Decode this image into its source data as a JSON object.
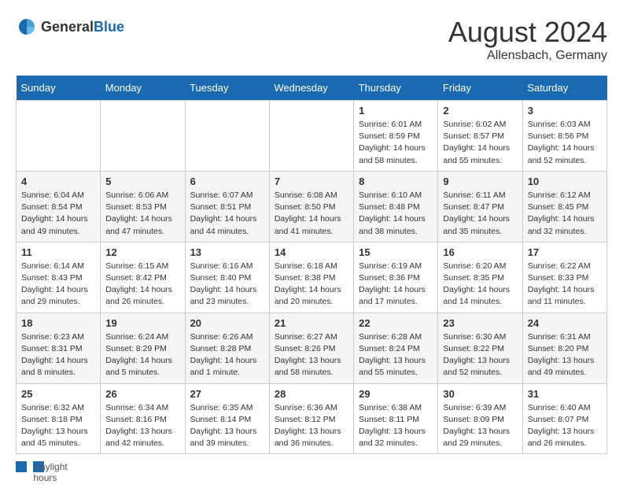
{
  "header": {
    "logo_general": "General",
    "logo_blue": "Blue",
    "month_year": "August 2024",
    "location": "Allensbach, Germany"
  },
  "days_of_week": [
    "Sunday",
    "Monday",
    "Tuesday",
    "Wednesday",
    "Thursday",
    "Friday",
    "Saturday"
  ],
  "weeks": [
    [
      {
        "day": "",
        "info": ""
      },
      {
        "day": "",
        "info": ""
      },
      {
        "day": "",
        "info": ""
      },
      {
        "day": "",
        "info": ""
      },
      {
        "day": "1",
        "sunrise": "Sunrise: 6:01 AM",
        "sunset": "Sunset: 8:59 PM",
        "daylight": "Daylight: 14 hours and 58 minutes."
      },
      {
        "day": "2",
        "sunrise": "Sunrise: 6:02 AM",
        "sunset": "Sunset: 8:57 PM",
        "daylight": "Daylight: 14 hours and 55 minutes."
      },
      {
        "day": "3",
        "sunrise": "Sunrise: 6:03 AM",
        "sunset": "Sunset: 8:56 PM",
        "daylight": "Daylight: 14 hours and 52 minutes."
      }
    ],
    [
      {
        "day": "4",
        "sunrise": "Sunrise: 6:04 AM",
        "sunset": "Sunset: 8:54 PM",
        "daylight": "Daylight: 14 hours and 49 minutes."
      },
      {
        "day": "5",
        "sunrise": "Sunrise: 6:06 AM",
        "sunset": "Sunset: 8:53 PM",
        "daylight": "Daylight: 14 hours and 47 minutes."
      },
      {
        "day": "6",
        "sunrise": "Sunrise: 6:07 AM",
        "sunset": "Sunset: 8:51 PM",
        "daylight": "Daylight: 14 hours and 44 minutes."
      },
      {
        "day": "7",
        "sunrise": "Sunrise: 6:08 AM",
        "sunset": "Sunset: 8:50 PM",
        "daylight": "Daylight: 14 hours and 41 minutes."
      },
      {
        "day": "8",
        "sunrise": "Sunrise: 6:10 AM",
        "sunset": "Sunset: 8:48 PM",
        "daylight": "Daylight: 14 hours and 38 minutes."
      },
      {
        "day": "9",
        "sunrise": "Sunrise: 6:11 AM",
        "sunset": "Sunset: 8:47 PM",
        "daylight": "Daylight: 14 hours and 35 minutes."
      },
      {
        "day": "10",
        "sunrise": "Sunrise: 6:12 AM",
        "sunset": "Sunset: 8:45 PM",
        "daylight": "Daylight: 14 hours and 32 minutes."
      }
    ],
    [
      {
        "day": "11",
        "sunrise": "Sunrise: 6:14 AM",
        "sunset": "Sunset: 8:43 PM",
        "daylight": "Daylight: 14 hours and 29 minutes."
      },
      {
        "day": "12",
        "sunrise": "Sunrise: 6:15 AM",
        "sunset": "Sunset: 8:42 PM",
        "daylight": "Daylight: 14 hours and 26 minutes."
      },
      {
        "day": "13",
        "sunrise": "Sunrise: 6:16 AM",
        "sunset": "Sunset: 8:40 PM",
        "daylight": "Daylight: 14 hours and 23 minutes."
      },
      {
        "day": "14",
        "sunrise": "Sunrise: 6:18 AM",
        "sunset": "Sunset: 8:38 PM",
        "daylight": "Daylight: 14 hours and 20 minutes."
      },
      {
        "day": "15",
        "sunrise": "Sunrise: 6:19 AM",
        "sunset": "Sunset: 8:36 PM",
        "daylight": "Daylight: 14 hours and 17 minutes."
      },
      {
        "day": "16",
        "sunrise": "Sunrise: 6:20 AM",
        "sunset": "Sunset: 8:35 PM",
        "daylight": "Daylight: 14 hours and 14 minutes."
      },
      {
        "day": "17",
        "sunrise": "Sunrise: 6:22 AM",
        "sunset": "Sunset: 8:33 PM",
        "daylight": "Daylight: 14 hours and 11 minutes."
      }
    ],
    [
      {
        "day": "18",
        "sunrise": "Sunrise: 6:23 AM",
        "sunset": "Sunset: 8:31 PM",
        "daylight": "Daylight: 14 hours and 8 minutes."
      },
      {
        "day": "19",
        "sunrise": "Sunrise: 6:24 AM",
        "sunset": "Sunset: 8:29 PM",
        "daylight": "Daylight: 14 hours and 5 minutes."
      },
      {
        "day": "20",
        "sunrise": "Sunrise: 6:26 AM",
        "sunset": "Sunset: 8:28 PM",
        "daylight": "Daylight: 14 hours and 1 minute."
      },
      {
        "day": "21",
        "sunrise": "Sunrise: 6:27 AM",
        "sunset": "Sunset: 8:26 PM",
        "daylight": "Daylight: 13 hours and 58 minutes."
      },
      {
        "day": "22",
        "sunrise": "Sunrise: 6:28 AM",
        "sunset": "Sunset: 8:24 PM",
        "daylight": "Daylight: 13 hours and 55 minutes."
      },
      {
        "day": "23",
        "sunrise": "Sunrise: 6:30 AM",
        "sunset": "Sunset: 8:22 PM",
        "daylight": "Daylight: 13 hours and 52 minutes."
      },
      {
        "day": "24",
        "sunrise": "Sunrise: 6:31 AM",
        "sunset": "Sunset: 8:20 PM",
        "daylight": "Daylight: 13 hours and 49 minutes."
      }
    ],
    [
      {
        "day": "25",
        "sunrise": "Sunrise: 6:32 AM",
        "sunset": "Sunset: 8:18 PM",
        "daylight": "Daylight: 13 hours and 45 minutes."
      },
      {
        "day": "26",
        "sunrise": "Sunrise: 6:34 AM",
        "sunset": "Sunset: 8:16 PM",
        "daylight": "Daylight: 13 hours and 42 minutes."
      },
      {
        "day": "27",
        "sunrise": "Sunrise: 6:35 AM",
        "sunset": "Sunset: 8:14 PM",
        "daylight": "Daylight: 13 hours and 39 minutes."
      },
      {
        "day": "28",
        "sunrise": "Sunrise: 6:36 AM",
        "sunset": "Sunset: 8:12 PM",
        "daylight": "Daylight: 13 hours and 36 minutes."
      },
      {
        "day": "29",
        "sunrise": "Sunrise: 6:38 AM",
        "sunset": "Sunset: 8:11 PM",
        "daylight": "Daylight: 13 hours and 32 minutes."
      },
      {
        "day": "30",
        "sunrise": "Sunrise: 6:39 AM",
        "sunset": "Sunset: 8:09 PM",
        "daylight": "Daylight: 13 hours and 29 minutes."
      },
      {
        "day": "31",
        "sunrise": "Sunrise: 6:40 AM",
        "sunset": "Sunset: 8:07 PM",
        "daylight": "Daylight: 13 hours and 26 minutes."
      }
    ]
  ],
  "footer": {
    "label": "Daylight hours"
  }
}
